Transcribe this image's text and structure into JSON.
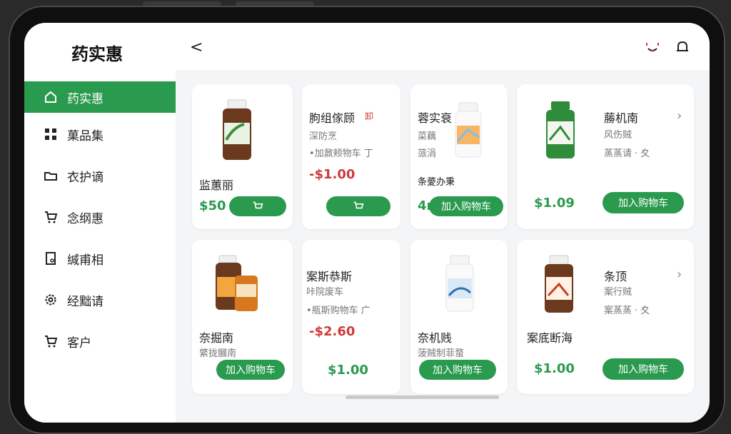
{
  "app": {
    "title": "药实惠"
  },
  "sidebar": {
    "items": [
      {
        "label": "药实惠",
        "icon": "home-icon",
        "active": true
      },
      {
        "label": "菓品集",
        "icon": "grid-icon"
      },
      {
        "label": "衣护谪",
        "icon": "folder-icon"
      },
      {
        "label": "念纲惠",
        "icon": "cart-icon"
      },
      {
        "label": "缄甫相",
        "icon": "document-icon"
      },
      {
        "label": "经黜请",
        "icon": "gear-icon"
      },
      {
        "label": "客户",
        "icon": "cart-icon"
      }
    ]
  },
  "header": {
    "back": "<",
    "icons": [
      "people-icon",
      "bell-icon"
    ]
  },
  "products": [
    {
      "name": "监蕙丽",
      "price": "$50",
      "btn": ""
    },
    {
      "name": "朐组傢顾",
      "tag": "卸",
      "sub1": "深防烹",
      "sub2": "•加鼐颊物车 丁",
      "price": "-$1.00"
    },
    {
      "name": "蓉实衰",
      "sub1": "菜藕",
      "sub2": "蒎涓",
      "extra": "条薆办秉",
      "btn": "加入购物车",
      "prefix": "4r"
    },
    {
      "name": "蕂机南",
      "sub1": "风伤贼",
      "sub2": "蒸蒸请 · 夊",
      "price": "$1.09",
      "btn": "加入购物车"
    },
    {
      "name": "奈掘南",
      "sub": "綮拢膕南",
      "btn": "加入购物车"
    },
    {
      "name": "案斯恭斯",
      "sub1": "咔院废车",
      "sub2": "•瓶斯购物车 广",
      "price": "-$2.60",
      "price2": "$1.00"
    },
    {
      "name": "奈机贱",
      "sub": "菠贼制菲蝥",
      "btn": "加入购物车"
    },
    {
      "name": "条顶",
      "sub1": "案行贼",
      "sub2": "案蒸蒸 · 夊",
      "name2": "案底断海",
      "price": "$1.00",
      "btn": "加入购物车"
    }
  ],
  "colors": {
    "accent": "#2a9a4e",
    "price_red": "#d03a3a"
  }
}
